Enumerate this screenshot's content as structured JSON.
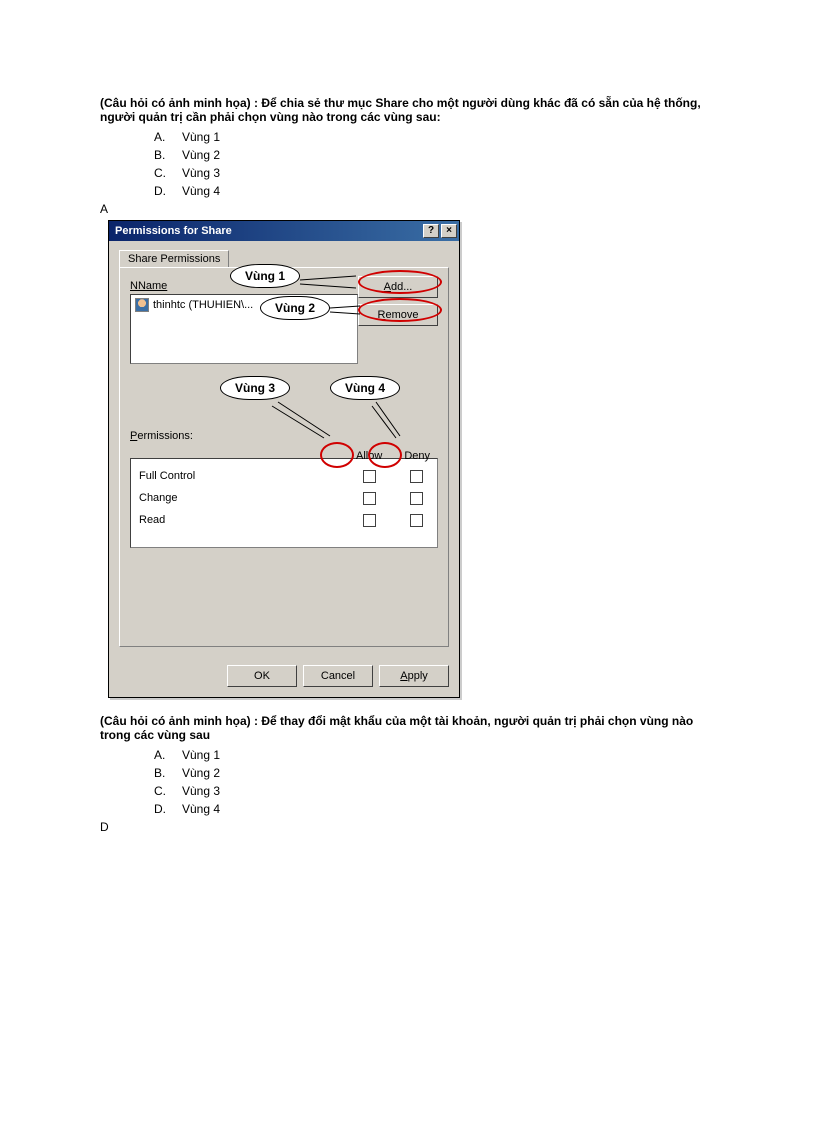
{
  "q1": {
    "prefix": "(Câu hỏi có ảnh minh họa) : ",
    "text": "Để chia sẻ thư mục Share cho một người dùng khác đã có sẵn của hệ thống, người quản trị cần phải chọn vùng nào trong các vùng sau:",
    "options": [
      {
        "label": "A.",
        "text": "Vùng 1"
      },
      {
        "label": "B.",
        "text": "Vùng 2"
      },
      {
        "label": "C.",
        "text": "Vùng 3"
      },
      {
        "label": "D.",
        "text": "Vùng 4"
      }
    ],
    "answer": "A"
  },
  "dialog": {
    "title": "Permissions for Share",
    "help_btn": "?",
    "close_btn": "×",
    "tab": "Share Permissions",
    "name_label": "Name",
    "list_item": "thinhtc (THUHIEN\\...",
    "add_btn": "Add...",
    "remove_btn": "Remove",
    "permissions_label": "Permissions:",
    "allow_header": "Allow",
    "deny_header": "Deny",
    "perm_rows": [
      "Full Control",
      "Change",
      "Read"
    ],
    "ok": "OK",
    "cancel": "Cancel",
    "apply": "Apply"
  },
  "bubbles": {
    "v1": "Vùng 1",
    "v2": "Vùng 2",
    "v3": "Vùng 3",
    "v4": "Vùng 4"
  },
  "q2": {
    "prefix": "(Câu hỏi có ảnh minh họa) : ",
    "text": "Để thay đổi mật khẩu của một tài khoản, người quản trị phải chọn vùng nào trong các vùng sau",
    "options": [
      {
        "label": "A.",
        "text": "Vùng 1"
      },
      {
        "label": "B.",
        "text": "Vùng 2"
      },
      {
        "label": "C.",
        "text": "Vùng 3"
      },
      {
        "label": "D.",
        "text": "Vùng 4"
      }
    ],
    "answer": "D"
  }
}
